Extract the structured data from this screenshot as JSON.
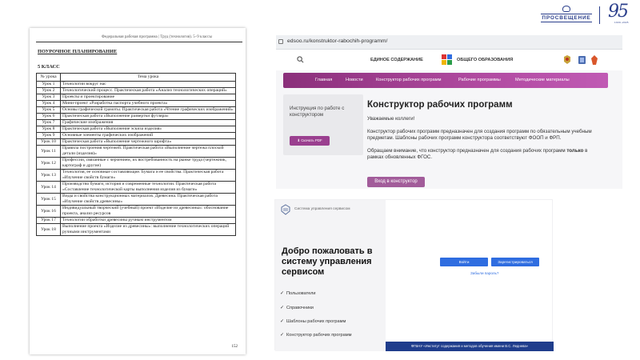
{
  "logos": {
    "prosv_text": "ПРОСВЕЩЕНИЕ",
    "anniv_number": "95",
    "anniv_sub": "1930–2025"
  },
  "document": {
    "header": "Федеральная рабочая программа | Труд (технология). 5–9 классы",
    "title": "ПОУРОЧНОЕ ПЛАНИРОВАНИЕ",
    "class_label": "5 КЛАСС",
    "columns": [
      "№ урока",
      "Тема урока"
    ],
    "rows": [
      {
        "n": "Урок 1",
        "t": "Технологии вокруг нас"
      },
      {
        "n": "Урок 2",
        "t": "Технологический процесс. Практическая работа «Анализ технологических операций»"
      },
      {
        "n": "Урок 3",
        "t": "Проекты и проектирование"
      },
      {
        "n": "Урок 4",
        "t": "Мини-проект «Разработка паспорта учебного проекта»"
      },
      {
        "n": "Урок 5",
        "t": "Основы графической грамоты. Практическая работа «Чтение графических изображений»"
      },
      {
        "n": "Урок 6",
        "t": "Практическая работа «Выполнение развертки футляра»"
      },
      {
        "n": "Урок 7",
        "t": "Графические изображения"
      },
      {
        "n": "Урок 8",
        "t": "Практическая работа «Выполнение эскиза изделия»"
      },
      {
        "n": "Урок 9",
        "t": "Основные элементы графических изображений"
      },
      {
        "n": "Урок 10",
        "t": "Практическая работа «Выполнение чертежного шрифта»"
      },
      {
        "n": "Урок 11",
        "t": "Правила построения чертежей. Практическая работа «Выполнение чертежа плоской детали (изделия)»"
      },
      {
        "n": "Урок 12",
        "t": "Профессии, связанные с черчением, их востребованность на рынке труда (чертежник, картограф и другие)"
      },
      {
        "n": "Урок 13",
        "t": "Технология, ее основные составляющие. Бумага и ее свойства. Практическая работа «Изучение свойств бумаги»"
      },
      {
        "n": "Урок 14",
        "t": "Производство бумаги, история и современные технологии. Практическая работа «Составление технологической карты выполнения изделия из бумаги»"
      },
      {
        "n": "Урок 15",
        "t": "Виды и свойства конструкционных материалов. Древесина. Практическая работа «Изучение свойств древесины»"
      },
      {
        "n": "Урок 16",
        "t": "Индивидуальный творческий (учебный) проект «Изделие из древесины»: обоснование проекта, анализ ресурсов"
      },
      {
        "n": "Урок 17",
        "t": "Технологии обработки древесины ручным инструментом"
      },
      {
        "n": "Урок 18",
        "t": "Выполнение проекта «Изделие из древесины»: выполнение технологических операций ручными инструментами"
      }
    ],
    "page_number": "152"
  },
  "browser": {
    "url": "edsoo.ru/konstruktor-rabochih-programm/",
    "brand_left": "ЕДИНОЕ СОДЕРЖАНИЕ",
    "brand_right": "ОБЩЕГО ОБРАЗОВАНИЯ",
    "nav": [
      "Главная",
      "Новости",
      "Конструктор рабочих программ",
      "Рабочие программы",
      "Методические материалы"
    ],
    "instruction_text": "Инструкция по работе с конструктором",
    "download_label": "Скачать PDF",
    "heading": "Конструктор рабочих программ",
    "greeting": "Уважаемые коллеги!",
    "para1": "Конструктор рабочих программ предназначен для создания программ по обязательным учебным предметам. Шаблоны рабочих программ конструктора соответствуют ФООП и ФРП.",
    "para2_a": "Обращаем внимание, что конструктор предназначен для создания рабочих программ ",
    "para2_b": "только",
    "para2_c": " в рамках обновленных ФГОС.",
    "enter_label": "Вход в конструктор"
  },
  "login": {
    "system_title": "Система управления сервисом",
    "welcome": "Добро пожаловать в систему управления сервисом",
    "items": [
      "Пользователи",
      "Справочники",
      "Шаблоны рабочих программ",
      "Конструктор рабочих программ"
    ],
    "login_button": "Войти",
    "register_button": "Зарегистрироваться",
    "forgot": "Забыли пароль?",
    "footer": "ФГБНУ «Институт содержания и методов обучения имени В.С. Леднева»"
  },
  "colors": {
    "nav_gradient_start": "#8a2f7a",
    "accent": "#a25c9a",
    "blue": "#2f6de0",
    "footer": "#1f3d8c"
  }
}
